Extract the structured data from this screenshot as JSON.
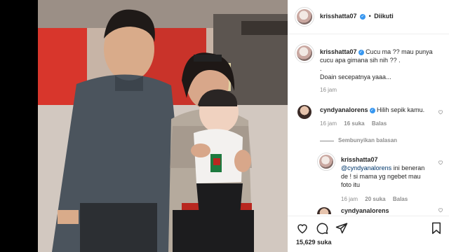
{
  "post": {
    "author": "krisshatta07",
    "follow_status": "Diikuti",
    "dot": "•",
    "caption_line1": "Cucu ma ?? mau punya",
    "caption_line2": "cucu apa gimana sih nih ?? .",
    "caption_dot": ".",
    "caption_line3": "Doain secepatnya yaaa...",
    "caption_time": "16 jam"
  },
  "comments": [
    {
      "user": "cyndyanalorens",
      "text": "Hilih sepik kamu.",
      "time": "16 jam",
      "likes": "16 suka",
      "reply_label": "Balas",
      "hide_replies": "Sembunyikan balasan"
    },
    {
      "user": "krisshatta07",
      "mention": "@cyndyanalorens",
      "text_line1": " ini beneran",
      "text_line2": "de ! si mama yg ngebet mau",
      "text_line3": "foto itu",
      "time": "16 jam",
      "likes": "20 suka",
      "reply_label": "Balas"
    },
    {
      "user": "cyndyanalorens"
    }
  ],
  "footer": {
    "likes_count": "15,629 suka"
  },
  "icons": {
    "heart": "heart-icon",
    "comment": "comment-icon",
    "share": "share-icon",
    "bookmark": "bookmark-icon",
    "more": "more-icon",
    "verified": "verified-icon"
  },
  "colors": {
    "verified": "#3897f0",
    "muted": "#8e8e8e",
    "text": "#262626"
  }
}
